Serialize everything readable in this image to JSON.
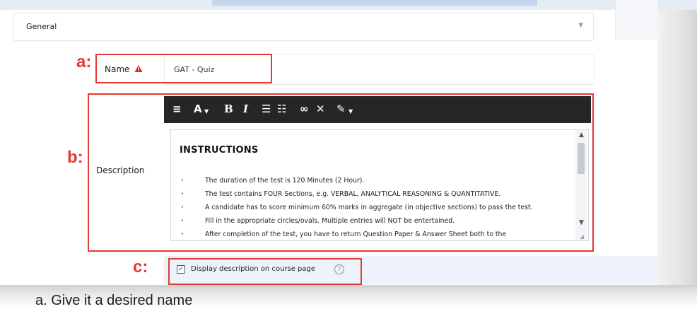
{
  "section": {
    "title": "General"
  },
  "name_field": {
    "label": "Name",
    "value": "GAT - Quiz"
  },
  "description": {
    "label": "Description",
    "heading": "INSTRUCTIONS",
    "items": [
      "The duration of the test is 120 Minutes (2 Hour).",
      "The test contains FOUR Sections, e.g. VERBAL, ANALYTICAL REASONING & QUANTITATIVE.",
      "A candidate has to score minimum 60% marks in aggregate (in objective sections) to pass the test.",
      "Fill in the appropriate circles/ovals. Multiple entries will NOT be entertained.",
      "After completion of the test, you have to return Question Paper & Answer Sheet both to the"
    ]
  },
  "toolbar": {
    "icons": [
      "menu-icon",
      "font-size-icon",
      "bold-icon",
      "italic-icon",
      "bullet-list-icon",
      "numbered-list-icon",
      "link-icon",
      "unlink-icon",
      "paint-brush-icon"
    ]
  },
  "display_option": {
    "label": "Display description on course page",
    "checked": true
  },
  "annotations": {
    "a": "a:",
    "b": "b:",
    "c": "c:"
  },
  "caption": "a.   Give it a desired name",
  "colors": {
    "annotation": "#e53935",
    "toolbar": "#262626",
    "option_bg": "#eef2fa"
  }
}
